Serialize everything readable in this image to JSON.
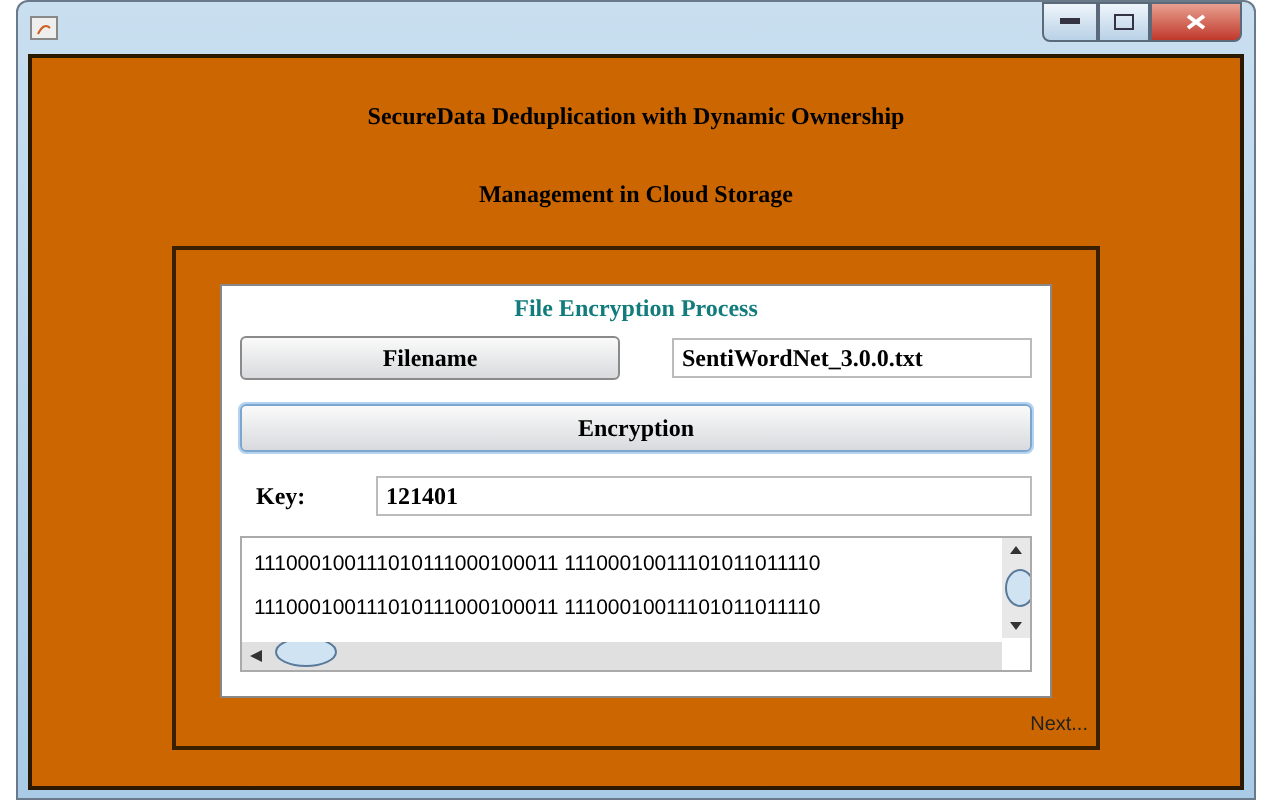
{
  "window": {
    "title_lines": [
      "SecureData Deduplication with Dynamic Ownership",
      "Management in Cloud Storage"
    ]
  },
  "panel": {
    "heading": "File Encryption Process",
    "filename_button": "Filename",
    "filename_value": "SentiWordNet_3.0.0.txt",
    "encryption_button": "Encryption",
    "encryption_focused": true,
    "key_label": "Key:",
    "key_value": "121401",
    "output_lines": [
      "111000100111010111000100011 11100010011101011011110",
      "111000100111010111000100011 11100010011101011011110"
    ]
  },
  "next_link": "Next..."
}
